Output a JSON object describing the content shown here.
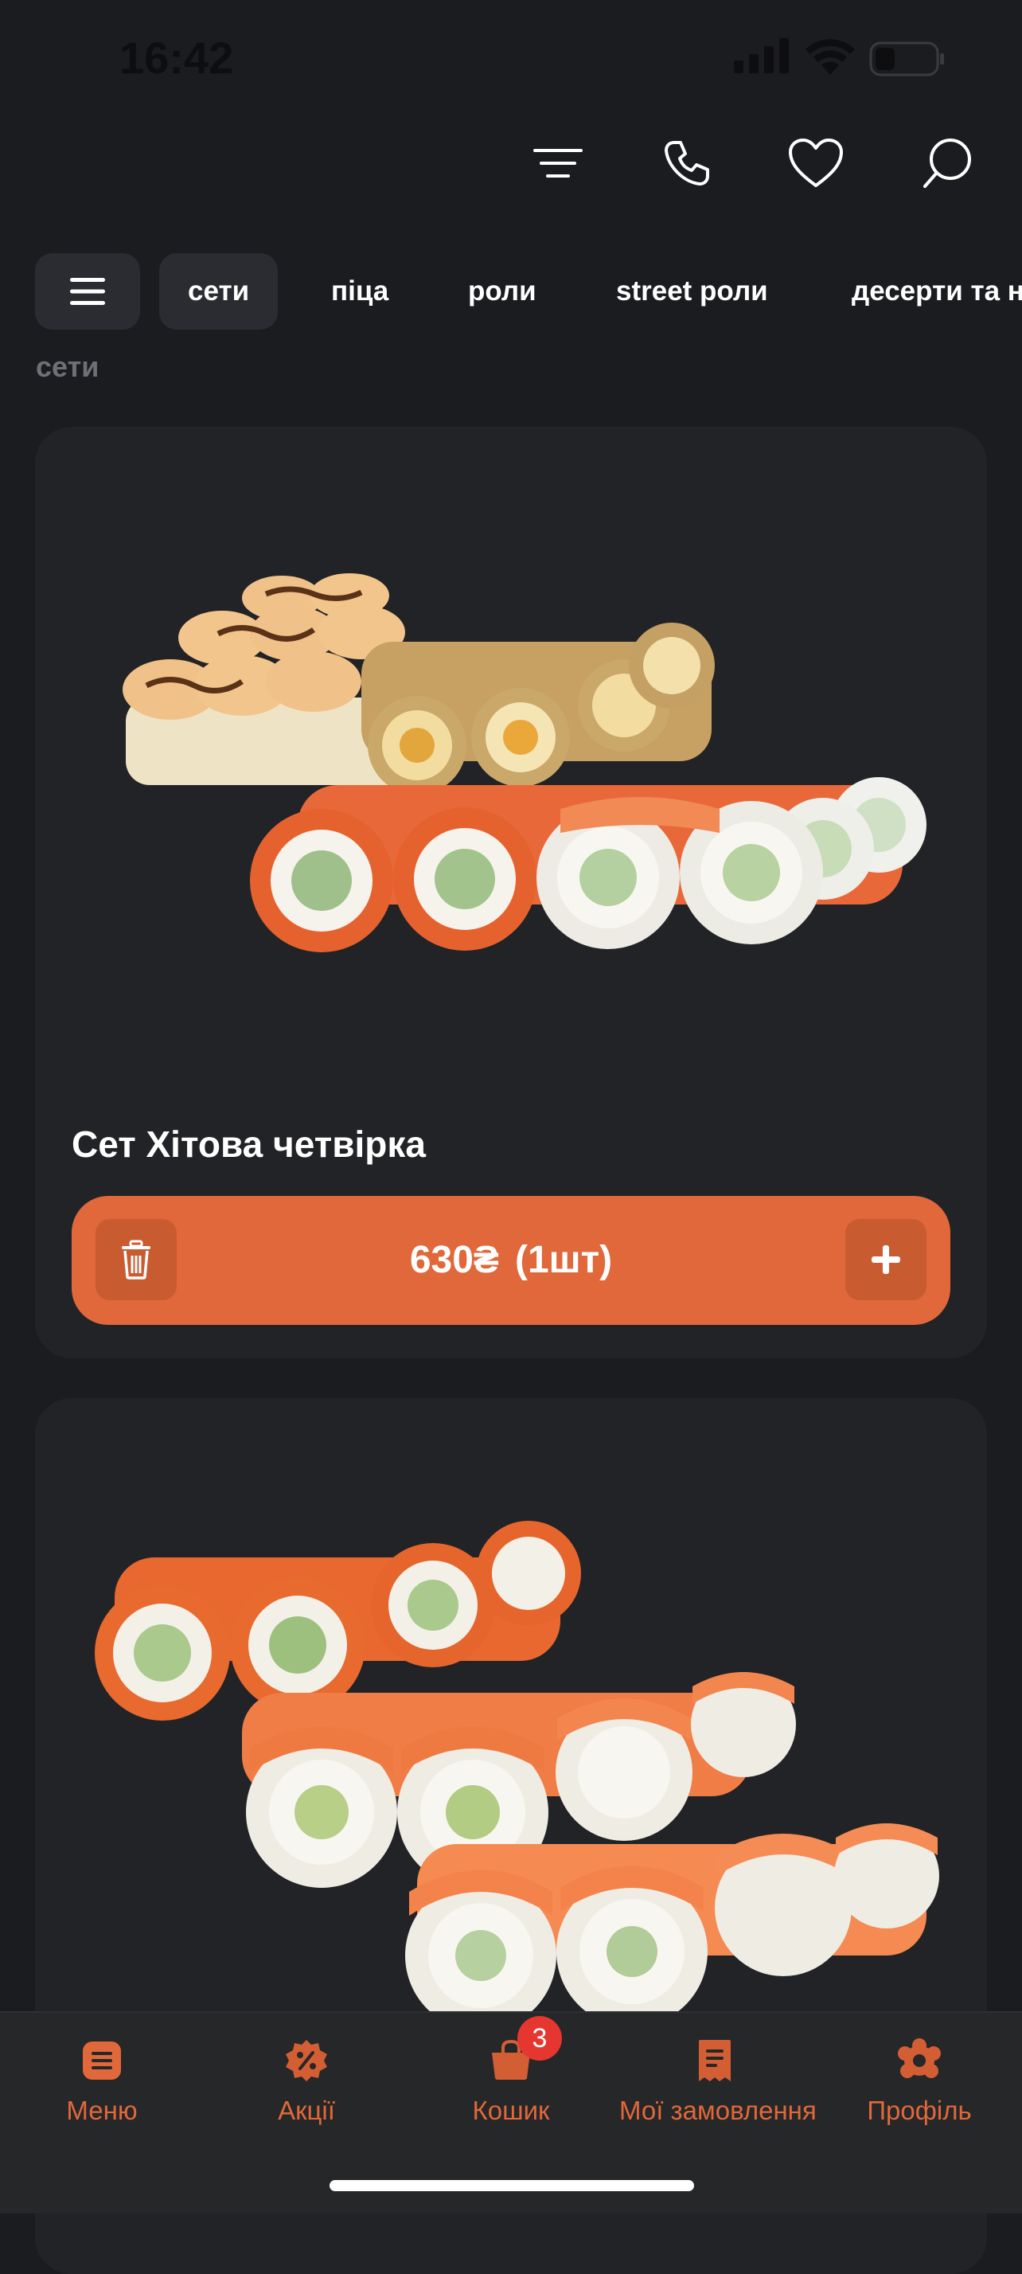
{
  "status_bar": {
    "time": "16:42"
  },
  "header": {
    "icons": [
      "sort-icon",
      "phone-icon",
      "heart-icon",
      "search-icon"
    ]
  },
  "tabs": {
    "items": [
      "сети",
      "піца",
      "роли",
      "street роли",
      "десерти та напої"
    ],
    "active": "сети"
  },
  "section_title": "сети",
  "products": [
    {
      "name": "Сет Хітова четвірка",
      "price": "630₴",
      "qty": "(1шт)"
    },
    {
      "name": ""
    }
  ],
  "bottom_nav": {
    "items": [
      {
        "label": "Меню",
        "icon": "menu-book-icon"
      },
      {
        "label": "Акції",
        "icon": "discount-icon"
      },
      {
        "label": "Кошик",
        "icon": "cart-icon",
        "badge": "3"
      },
      {
        "label": "Мої замовлення",
        "icon": "receipt-icon"
      },
      {
        "label": "Профіль",
        "icon": "profile-icon"
      }
    ]
  },
  "colors": {
    "accent": "#e0683a",
    "background": "#1b1c20",
    "card": "#222327",
    "badge": "#e5362f"
  }
}
